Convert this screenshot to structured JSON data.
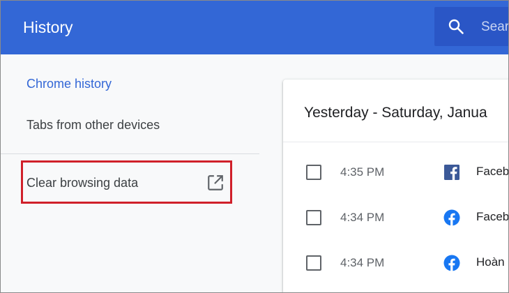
{
  "header": {
    "title": "History",
    "search": {
      "icon": "search-icon",
      "placeholder": "Sear"
    }
  },
  "sidebar": {
    "items": [
      {
        "label": "Chrome history",
        "selected": true
      },
      {
        "label": "Tabs from other devices",
        "selected": false
      }
    ],
    "clear": {
      "label": "Clear browsing data",
      "icon": "open-in-new-icon"
    }
  },
  "history": {
    "day_heading": "Yesterday - Saturday, Janua",
    "entries": [
      {
        "time": "4:35 PM",
        "favicon": "facebook-square-icon",
        "title": "Faceb"
      },
      {
        "time": "4:34 PM",
        "favicon": "facebook-circle-icon",
        "title": "Faceb"
      },
      {
        "time": "4:34 PM",
        "favicon": "facebook-circle-icon",
        "title": "Hoàn"
      }
    ]
  },
  "colors": {
    "header_bg": "#3367d6",
    "search_bg": "#2a56c6",
    "link_blue": "#3367d6",
    "highlight_red": "#d0202a",
    "facebook_blue": "#1877f2",
    "facebook_square": "#3b5998"
  }
}
